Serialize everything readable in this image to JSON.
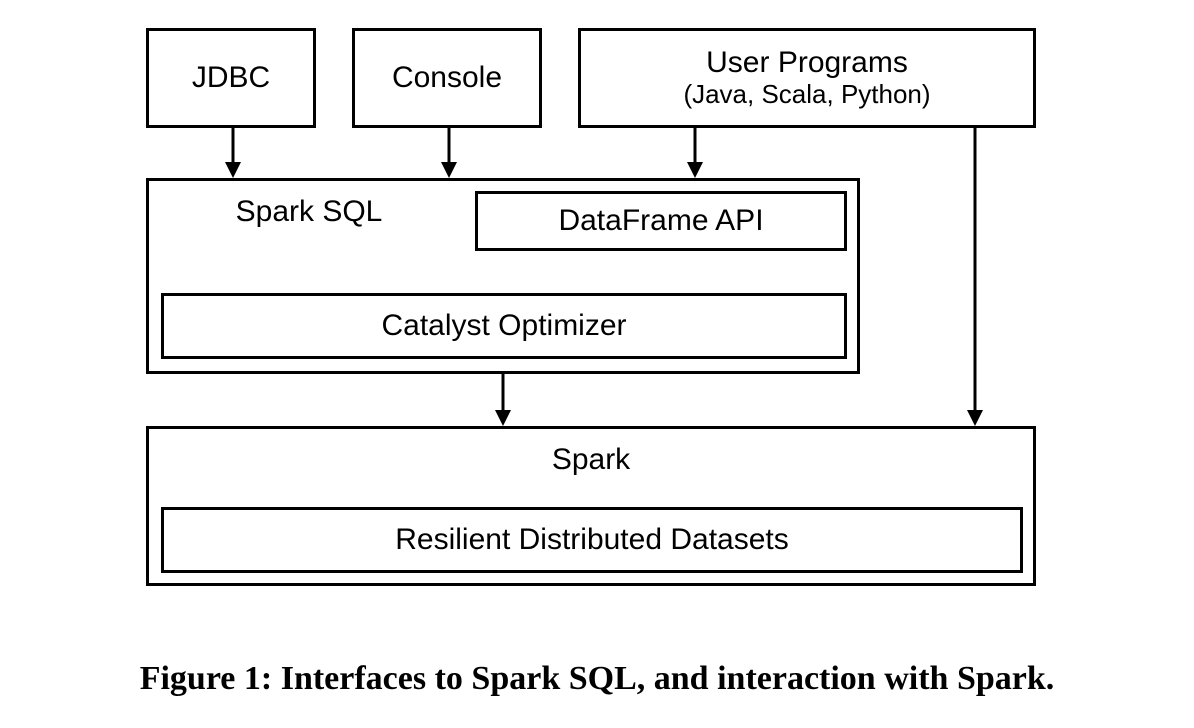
{
  "diagram": {
    "top_boxes": {
      "jdbc": "JDBC",
      "console": "Console",
      "user_programs_title": "User Programs",
      "user_programs_sub": "(Java, Scala, Python)"
    },
    "spark_sql": {
      "title": "Spark SQL",
      "dataframe_api": "DataFrame API",
      "catalyst": "Catalyst Optimizer"
    },
    "spark": {
      "title": "Spark",
      "rdd": "Resilient Distributed Datasets"
    }
  },
  "caption": "Figure 1: Interfaces to Spark SQL, and interaction with Spark."
}
